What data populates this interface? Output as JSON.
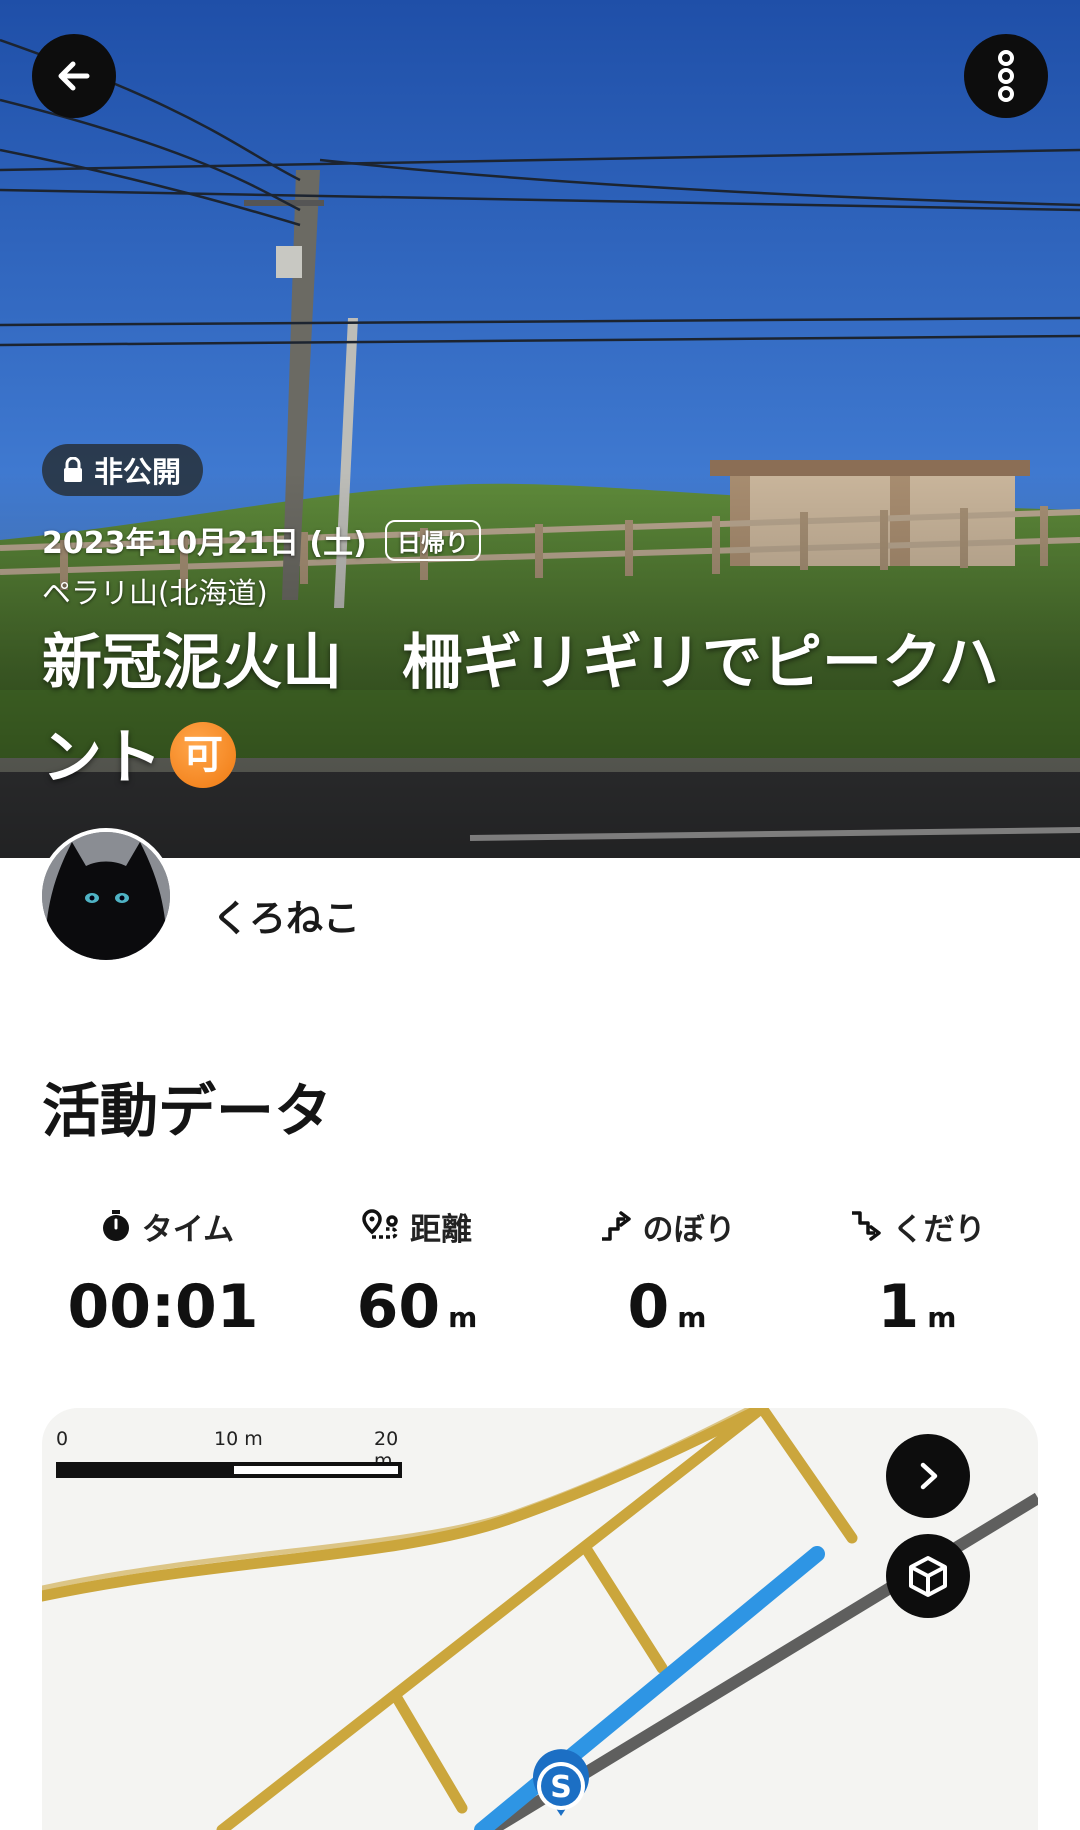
{
  "header": {
    "back_icon": "arrow-left-icon",
    "more_icon": "more-vertical-icon"
  },
  "hero": {
    "privacy_label": "非公開",
    "date": "2023年10月21日 (土)",
    "trip_type": "日帰り",
    "mountain": "ペラリ山(北海道)",
    "title": "新冠泥火山　柵ギリギリでピークハント",
    "ok_badge": "可"
  },
  "user": {
    "name": "くろねこ"
  },
  "activity": {
    "section_title": "活動データ",
    "stats": [
      {
        "icon": "stopwatch-icon",
        "label": "タイム",
        "value": "00:01",
        "unit": ""
      },
      {
        "icon": "route-distance-icon",
        "label": "距離",
        "value": "60",
        "unit": "m"
      },
      {
        "icon": "ascent-icon",
        "label": "のぼり",
        "value": "0",
        "unit": "m"
      },
      {
        "icon": "descent-icon",
        "label": "くだり",
        "value": "1",
        "unit": "m"
      }
    ]
  },
  "map": {
    "scale_labels": [
      "0",
      "10 m",
      "20 m"
    ],
    "start_marker": "S",
    "colors": {
      "track": "#2e95e4",
      "road": "#c9a233",
      "rail": "#444444"
    }
  }
}
